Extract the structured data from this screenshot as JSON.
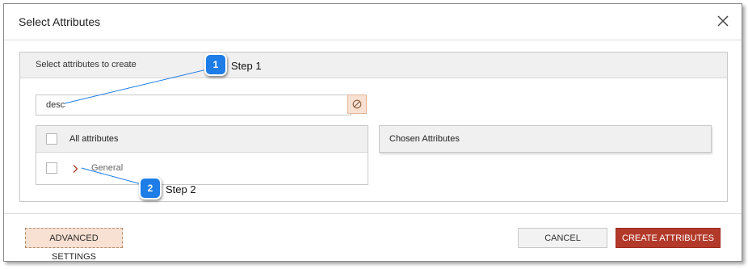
{
  "dialog": {
    "title": "Select Attributes",
    "close_icon": "close-icon"
  },
  "panel": {
    "header_label": "Select attributes to create",
    "search": {
      "value": "desc",
      "placeholder": ""
    },
    "clear_icon": "no-entry-icon",
    "all_attributes": {
      "header_label": "All attributes",
      "items": [
        {
          "label": "General",
          "icon": "chevron-right-icon"
        }
      ]
    },
    "chosen_attributes": {
      "header_label": "Chosen Attributes"
    }
  },
  "footer": {
    "advanced_label": "ADVANCED SETTINGS",
    "cancel_label": "CANCEL",
    "create_label": "CREATE ATTRIBUTES"
  },
  "callouts": [
    {
      "number": "1",
      "label": "Step 1"
    },
    {
      "number": "2",
      "label": "Step 2"
    }
  ],
  "colors": {
    "accent": "#b33a2a",
    "accent_light": "#f8e1d3",
    "callout_blue": "#1e7de6"
  }
}
